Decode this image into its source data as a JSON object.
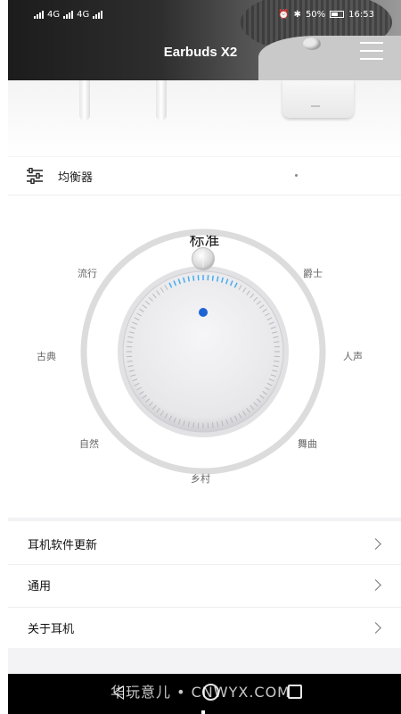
{
  "status_bar": {
    "left_icons": [
      "sim-icon",
      "signal-icon",
      "sim-icon",
      "signal-icon"
    ],
    "network_1": "4G",
    "network_2": "4G",
    "battery": "50%",
    "time": "16:53"
  },
  "header": {
    "title": "Earbuds X2",
    "menu_icon": "hamburger-menu-icon"
  },
  "equalizer": {
    "icon": "sliders-icon",
    "label": "均衡器",
    "selected_preset": "标准",
    "modes": [
      {
        "key": "pop",
        "label": "流行"
      },
      {
        "key": "jazz",
        "label": "爵士"
      },
      {
        "key": "classical",
        "label": "古典"
      },
      {
        "key": "vocal",
        "label": "人声"
      },
      {
        "key": "natural",
        "label": "自然"
      },
      {
        "key": "dance",
        "label": "舞曲"
      },
      {
        "key": "country",
        "label": "乡村"
      }
    ],
    "accent_color": "#1e63d6",
    "tick_active_color": "#3da8f0"
  },
  "settings_list": [
    {
      "label": "耳机软件更新",
      "icon": "chevron-right-icon"
    },
    {
      "label": "通用",
      "icon": "chevron-right-icon"
    },
    {
      "label": "关于耳机",
      "icon": "chevron-right-icon"
    }
  ],
  "nav_bar": {
    "back_icon": "back-triangle-icon",
    "home_icon": "home-circle-icon",
    "recent_icon": "recent-square-icon"
  },
  "watermark": "华玩意儿 • CNWYX.COM"
}
